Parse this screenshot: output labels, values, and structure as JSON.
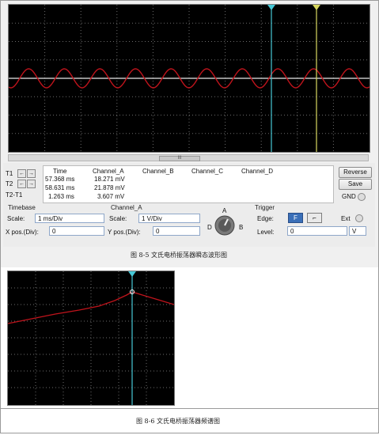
{
  "cursor_table": {
    "headers": [
      "Time",
      "Channel_A",
      "Channel_B",
      "Channel_C",
      "Channel_D"
    ],
    "rows": [
      {
        "label": "T1",
        "time": "57.368 ms",
        "channel_a": "18.271 mV"
      },
      {
        "label": "T2",
        "time": "58.631 ms",
        "channel_a": "21.878 mV"
      },
      {
        "label": "T2-T1",
        "time": "1.263 ms",
        "channel_a": "3.607 mV"
      }
    ],
    "arrow_left": "←",
    "arrow_right": "→"
  },
  "buttons": {
    "reverse": "Reverse",
    "save": "Save",
    "gnd": "GND"
  },
  "timebase": {
    "title": "Timebase",
    "scale_label": "Scale:",
    "scale_value": "1 ms/Div",
    "xpos_label": "X pos.(Div):",
    "xpos_value": "0"
  },
  "channel_a": {
    "title": "Channel_A",
    "scale_label": "Scale:",
    "scale_value": "1  V/Div",
    "ypos_label": "Y pos.(Div):",
    "ypos_value": "0"
  },
  "selector": {
    "a": "A",
    "b": "B",
    "d": "D"
  },
  "trigger": {
    "title": "Trigger",
    "edge_label": "Edge:",
    "level_label": "Level:",
    "level_value": "0",
    "level_unit": "V",
    "ext_label": "Ext",
    "rising_glyph": "F",
    "falling_glyph": "⌐"
  },
  "scrollbar_grip": "III",
  "captions": {
    "fig85": "图 8-5  文氏电桥振荡器瞬态波形图",
    "fig86": "图 8-6  文氏电桥振荡器频谱图"
  },
  "colors": {
    "trace": "#c0141c",
    "cursor1": "#46c8d6",
    "cursor2": "#d8d860",
    "grid": "#6b6b6b",
    "screen": "#000000"
  }
}
